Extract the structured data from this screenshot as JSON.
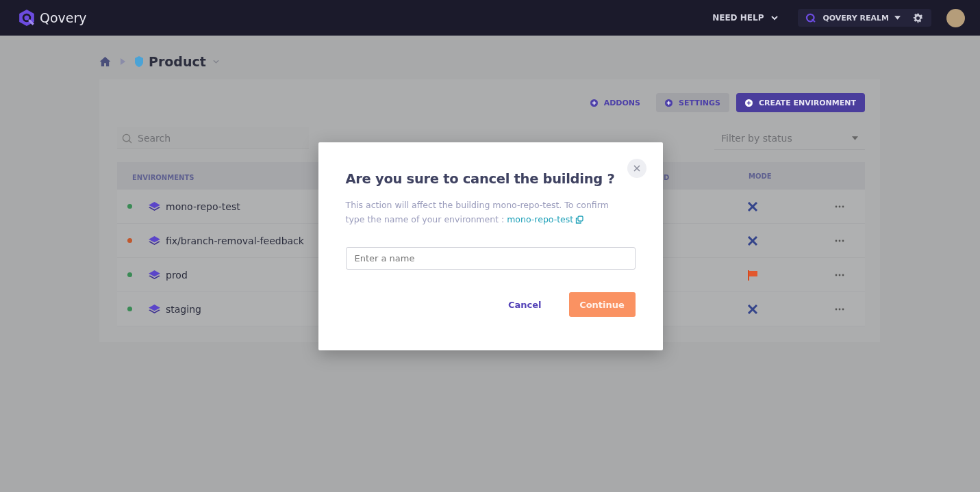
{
  "topbar": {
    "logo": "Qovery",
    "help": "NEED HELP",
    "org": "QOVERY REALM"
  },
  "breadcrumb": {
    "project": "Product"
  },
  "actions": [
    {
      "label": "ADDONS",
      "kind": "plain"
    },
    {
      "label": "SETTINGS",
      "kind": "secondary"
    },
    {
      "label": "CREATE ENVIRONMENT",
      "kind": "primary"
    }
  ],
  "search": {
    "placeholder": "Search"
  },
  "filter": {
    "placeholder": "Filter by status"
  },
  "table": {
    "columns": [
      "ENVIRONMENTS",
      "D",
      "MODE"
    ],
    "rows": [
      {
        "name": "mono-repo-test",
        "color": "#3a8a55",
        "kind": "wrench"
      },
      {
        "name": "fix/branch-removal-feedback",
        "color": "#c0582e",
        "kind": "wrench"
      },
      {
        "name": "prod",
        "color": "#3a8a55",
        "kind": "flag"
      },
      {
        "name": "staging",
        "color": "#3a8a55",
        "kind": "wrench"
      }
    ]
  },
  "modal": {
    "title": "Are you sure to cancel the building ?",
    "text": "This action will affect the building mono-repo-test. To confirm type the name of your environment :",
    "link": "mono-repo-test",
    "placeholder": "Enter a name",
    "cancel": "Cancel",
    "confirm": "Continue"
  }
}
